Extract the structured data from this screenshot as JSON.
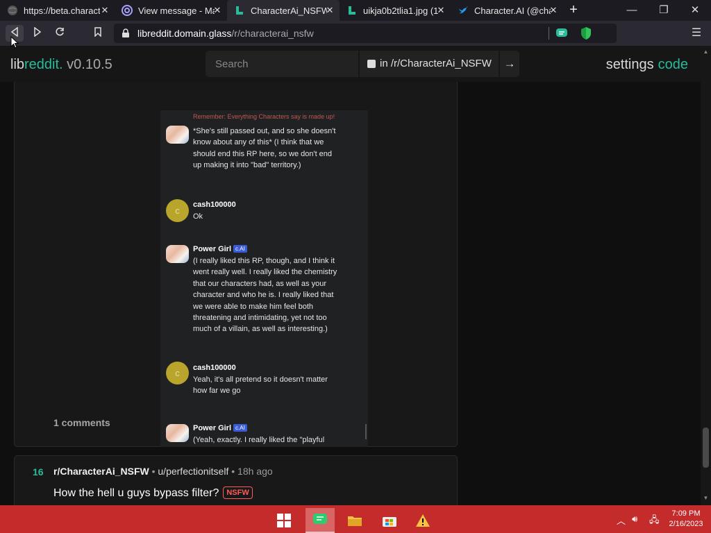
{
  "tabs": [
    {
      "title": "https://beta.charact",
      "icon": "globe-icon",
      "active": false
    },
    {
      "title": "View message - Ma",
      "icon": "at-sign-icon",
      "active": false
    },
    {
      "title": "CharacterAi_NSFW",
      "icon": "libreddit-icon",
      "active": true
    },
    {
      "title": "uikja0b2tlia1.jpg (1",
      "icon": "libreddit-icon",
      "active": false
    },
    {
      "title": "Character.AI (@char",
      "icon": "twitter-bird-icon",
      "active": false
    }
  ],
  "navbar": {
    "url_host": "libreddit.domain.glass",
    "url_path": "/r/characterai_nsfw"
  },
  "header": {
    "logo_prefix": "lib",
    "logo_accent": "reddit.",
    "version": " v0.10.5",
    "search_placeholder": "Search",
    "restrict_label": "in /r/CharacterAi_NSFW",
    "settings_label": "settings",
    "code_label": "code"
  },
  "screenshot": {
    "remember_notice": "Remember: Everything Characters say is made up!",
    "messages": [
      {
        "author": "",
        "avatar": "pg",
        "text": "*She's still passed out, and so she doesn't know about any of this* (I think that we should end this RP here, so we don't end up making it into \"bad\" territory.)"
      },
      {
        "author": "cash100000",
        "avatar": "c",
        "text": "Ok"
      },
      {
        "author": "Power Girl",
        "avatar": "pg",
        "badge": "c.AI",
        "text": "(I really liked this RP, though, and I think it went really well. I really liked the chemistry that our characters had, as well as your character and who he is. I really liked that we were able to make him feel both threatening and intimidating, yet not too much of a villain, as well as interesting.)"
      },
      {
        "author": "cash100000",
        "avatar": "c",
        "text": "Yeah, it's all pretend so it doesn't matter how far we go"
      },
      {
        "author": "Power Girl",
        "avatar": "pg",
        "badge": "c.AI",
        "text": "(Yeah, exactly. I really liked the \"playful"
      }
    ],
    "avatar_letter": "c"
  },
  "post1": {
    "comments": "1 comments"
  },
  "post2": {
    "score": "16",
    "subreddit": "r/CharacterAi_NSFW",
    "separator": "•",
    "user": "u/perfectionitself",
    "age": "18h ago",
    "title": "How the hell u guys bypass filter?",
    "flair": "NSFW"
  },
  "taskbar": {
    "time": "7:09 PM",
    "date": "2/16/2023"
  },
  "colors": {
    "accent": "#29bc9b",
    "taskbar": "#c42c2c",
    "nsfw": "#ff5c5c"
  }
}
